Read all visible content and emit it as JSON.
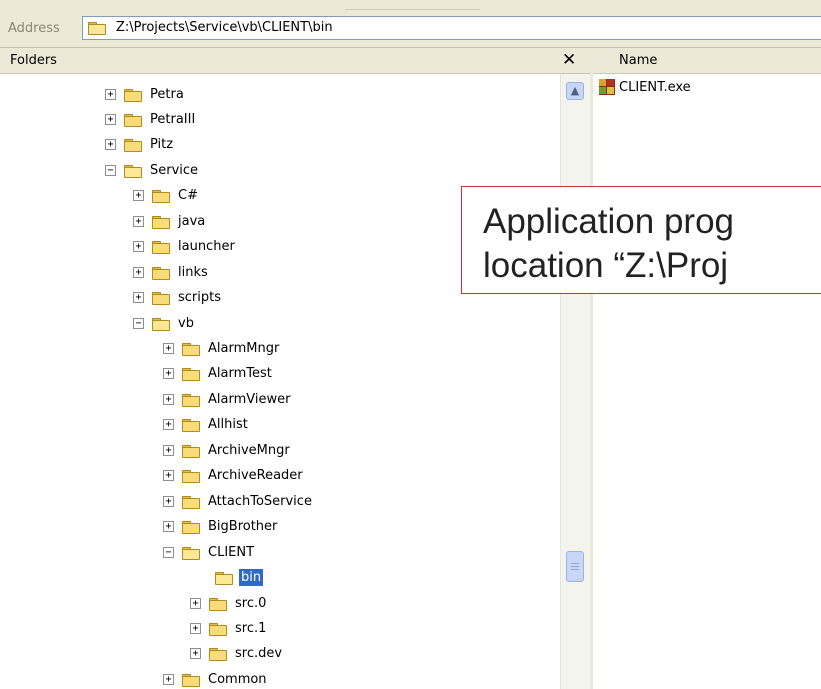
{
  "address": {
    "label": "Address",
    "value": "Z:\\Projects\\Service\\vb\\CLIENT\\bin"
  },
  "folders_pane": {
    "title": "Folders",
    "close_glyph": "✕"
  },
  "tree": [
    {
      "label": "Petra",
      "expander": "+",
      "open": false,
      "selected": false
    },
    {
      "label": "PetraIII",
      "expander": "+",
      "open": false,
      "selected": false
    },
    {
      "label": "Pitz",
      "expander": "+",
      "open": false,
      "selected": false
    },
    {
      "label": "Service",
      "expander": "−",
      "open": true,
      "selected": false
    },
    {
      "label": "C#",
      "expander": "+",
      "open": false,
      "selected": false
    },
    {
      "label": "java",
      "expander": "+",
      "open": false,
      "selected": false
    },
    {
      "label": "launcher",
      "expander": "+",
      "open": false,
      "selected": false
    },
    {
      "label": "links",
      "expander": "+",
      "open": false,
      "selected": false
    },
    {
      "label": "scripts",
      "expander": "+",
      "open": false,
      "selected": false
    },
    {
      "label": "vb",
      "expander": "−",
      "open": true,
      "selected": false
    },
    {
      "label": "AlarmMngr",
      "expander": "+",
      "open": false,
      "selected": false
    },
    {
      "label": "AlarmTest",
      "expander": "+",
      "open": false,
      "selected": false
    },
    {
      "label": "AlarmViewer",
      "expander": "+",
      "open": false,
      "selected": false
    },
    {
      "label": "Allhist",
      "expander": "+",
      "open": false,
      "selected": false
    },
    {
      "label": "ArchiveMngr",
      "expander": "+",
      "open": false,
      "selected": false
    },
    {
      "label": "ArchiveReader",
      "expander": "+",
      "open": false,
      "selected": false
    },
    {
      "label": "AttachToService",
      "expander": "+",
      "open": false,
      "selected": false
    },
    {
      "label": "BigBrother",
      "expander": "+",
      "open": false,
      "selected": false
    },
    {
      "label": "CLIENT",
      "expander": "−",
      "open": true,
      "selected": false
    },
    {
      "label": "bin",
      "expander": "",
      "open": true,
      "selected": true
    },
    {
      "label": "src.0",
      "expander": "+",
      "open": false,
      "selected": false
    },
    {
      "label": "src.1",
      "expander": "+",
      "open": false,
      "selected": false
    },
    {
      "label": "src.dev",
      "expander": "+",
      "open": false,
      "selected": false
    },
    {
      "label": "Common",
      "expander": "+",
      "open": false,
      "selected": false
    }
  ],
  "files_pane": {
    "column_name": "Name",
    "files": [
      {
        "name": "CLIENT.exe",
        "icon": "exe-icon"
      }
    ]
  },
  "callout": {
    "line1": "Application prog",
    "line2": "location “Z:\\Proj"
  },
  "colors": {
    "selection": "#316ac5",
    "callout_border": "#d03030",
    "folder_yellow": "#f8dc7a"
  }
}
